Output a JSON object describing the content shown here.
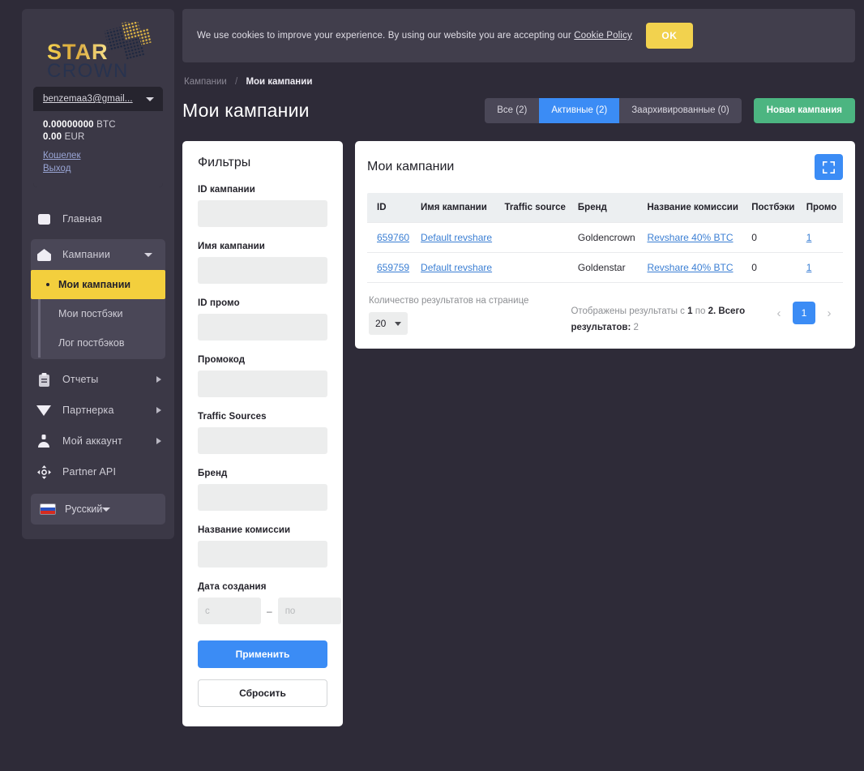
{
  "brand": {
    "logo_top": "STAR",
    "logo_bottom": "CROWN"
  },
  "account": {
    "email": "benzemaa3@gmail...",
    "balances": [
      {
        "amount": "0.00000000",
        "currency": "BTC"
      },
      {
        "amount": "0.00",
        "currency": "EUR"
      }
    ],
    "links": [
      {
        "label": "Кошелек"
      },
      {
        "label": "Выход"
      }
    ]
  },
  "sidebar": {
    "items": [
      {
        "label": "Главная",
        "icon": "dashboard-icon",
        "has_arrow": false
      },
      {
        "label": "Кампании",
        "icon": "home-icon",
        "expanded": true
      },
      {
        "label": "Отчеты",
        "icon": "clipboard-icon",
        "has_arrow": true
      },
      {
        "label": "Партнерка",
        "icon": "diamond-icon",
        "has_arrow": true
      },
      {
        "label": "Мой аккаунт",
        "icon": "user-icon",
        "has_arrow": true
      },
      {
        "label": "Partner API",
        "icon": "move-arrows-icon",
        "has_arrow": false
      }
    ],
    "campaigns_sub": [
      {
        "label": "Мои кампании",
        "active": true
      },
      {
        "label": "Мои постбэки",
        "active": false
      },
      {
        "label": "Лог постбэков",
        "active": false
      }
    ],
    "language": {
      "label": "Русский",
      "flag": "ru-flag-icon"
    }
  },
  "cookie": {
    "text_before": "We use cookies to improve your experience. By using our website you are accepting our ",
    "link": "Cookie Policy",
    "ok_label": "OK",
    "accent": "#f2d24e"
  },
  "breadcrumb": {
    "parent": "Кампании",
    "separator": "/",
    "current": "Мои кампании"
  },
  "header": {
    "title": "Мои кампании",
    "tabs": [
      {
        "label": "Все (2)",
        "active": false
      },
      {
        "label": "Активные (2)",
        "active": true
      },
      {
        "label": "Заархивированные (0)",
        "active": false
      }
    ],
    "new_campaign_label": "Новая кампания",
    "accent_blue": "#3b8cf5",
    "accent_green": "#4cb581"
  },
  "filters": {
    "title": "Фильтры",
    "fields": [
      {
        "label": "ID кампании",
        "value": "",
        "placeholder": ""
      },
      {
        "label": "Имя кампании",
        "value": "",
        "placeholder": ""
      },
      {
        "label": "ID промо",
        "value": "",
        "placeholder": ""
      },
      {
        "label": "Промокод",
        "value": "",
        "placeholder": ""
      },
      {
        "label": "Traffic Sources",
        "value": "",
        "placeholder": ""
      },
      {
        "label": "Бренд",
        "value": "",
        "placeholder": ""
      },
      {
        "label": "Название комиссии",
        "value": "",
        "placeholder": ""
      }
    ],
    "date": {
      "label": "Дата создания",
      "from_placeholder": "с",
      "from_value": "",
      "to_placeholder": "по",
      "to_value": "",
      "separator": "–"
    },
    "apply_label": "Применить",
    "reset_label": "Сбросить"
  },
  "table": {
    "title": "Мои кампании",
    "expand_icon": "fullscreen-icon",
    "columns": [
      "ID",
      "Имя кампании",
      "Traffic source",
      "Бренд",
      "Название комиссии",
      "Постбэки",
      "Промо"
    ],
    "rows": [
      {
        "id": "659760",
        "campaign_name": "Default revshare",
        "traffic_source": "",
        "brand": "Goldencrown",
        "commission_name": "Revshare 40% BTC",
        "postbacks": "0",
        "promo": "1"
      },
      {
        "id": "659759",
        "campaign_name": "Default revshare",
        "traffic_source": "",
        "brand": "Goldenstar",
        "commission_name": "Revshare 40% BTC",
        "postbacks": "0",
        "promo": "1"
      }
    ]
  },
  "pagination": {
    "per_page_label": "Количество результатов на странице",
    "per_page_value": "20",
    "results_prefix": "Отображены результаты с ",
    "results_from": "1",
    "results_mid": " по ",
    "results_to": "2",
    "results_total_label": ". Всего результатов: ",
    "results_total": "2",
    "prev": "‹",
    "current_page": "1",
    "next": "›"
  }
}
